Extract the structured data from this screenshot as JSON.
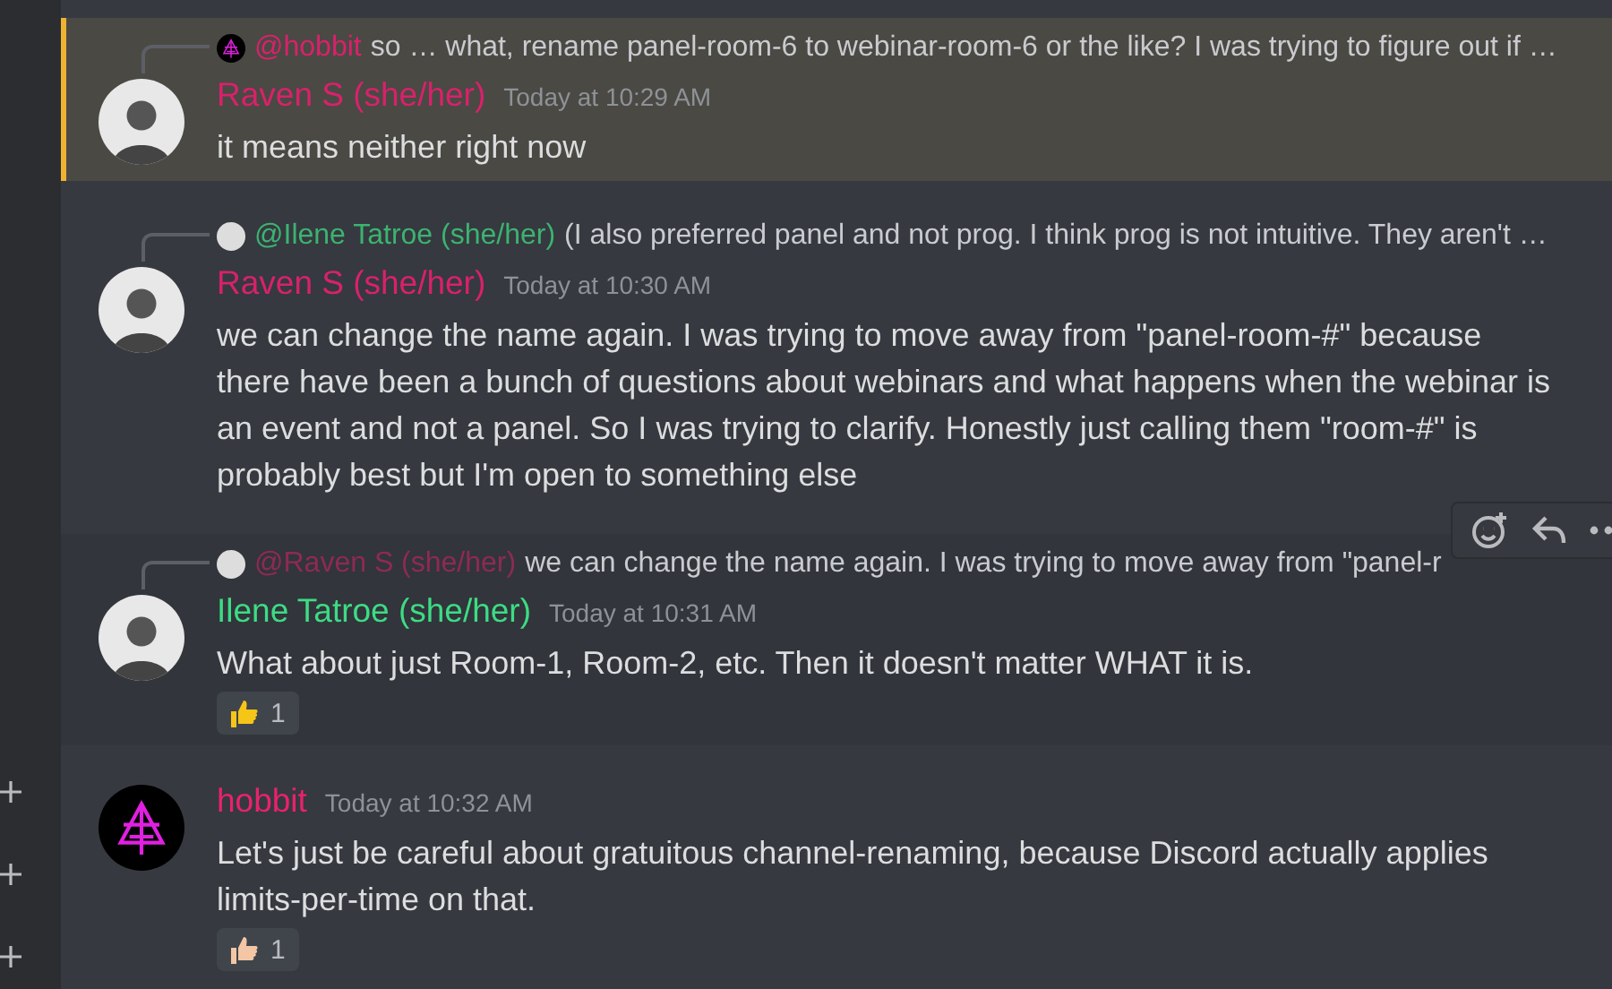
{
  "messages": [
    {
      "mentioned": true,
      "hovered": false,
      "avatar": {
        "kind": "photo"
      },
      "author": "Raven S (she/her)",
      "color": "#d9216b",
      "time": "Today at 10:29 AM",
      "reply": {
        "avatar": {
          "kind": "sigil"
        },
        "author": "@hobbit",
        "color": "#d9216b",
        "text": "so … what, rename panel-room-6 to webinar-room-6 or the like?  I was trying to figure out if …"
      },
      "text": "it means neither right now"
    },
    {
      "mentioned": false,
      "hovered": false,
      "avatar": {
        "kind": "photo"
      },
      "author": "Raven S (she/her)",
      "color": "#d9216b",
      "time": "Today at 10:30 AM",
      "reply": {
        "avatar": {
          "kind": "photo"
        },
        "author": "@Ilene Tatroe (she/her)",
        "color": "#3cb371",
        "text": "(I also preferred panel and not prog. I think prog is not intuitive. They aren't …"
      },
      "text": "we can change the name again. I was trying to move away from \"panel-room-#\" because there have been a bunch of questions about webinars and what happens when the webinar is an event and not a panel. So I was trying to clarify. Honestly just calling them \"room-#\" is probably best but I'm open to something else"
    },
    {
      "mentioned": false,
      "hovered": true,
      "avatar": {
        "kind": "photo"
      },
      "author": "Ilene Tatroe (she/her)",
      "color": "#3ddc84",
      "time": "Today at 10:31 AM",
      "reply": {
        "avatar": {
          "kind": "photo"
        },
        "author": "@Raven S (she/her)",
        "color": "#8e2a55",
        "text": "we can change the name again. I was trying to move away from \"panel-r"
      },
      "text": "What about just Room-1, Room-2, etc. Then it doesn't matter WHAT it is.",
      "reactions": [
        {
          "count": "1",
          "color": "#f5c518"
        }
      ]
    },
    {
      "mentioned": false,
      "hovered": false,
      "avatar": {
        "kind": "sigil"
      },
      "author": "hobbit",
      "color": "#e8226e",
      "time": "Today at 10:32 AM",
      "text": "Let's just be careful about gratuitous channel-renaming, because Discord actually applies limits-per-time on that.",
      "reactions": [
        {
          "count": "1",
          "color": "#f3c6a5"
        }
      ]
    }
  ]
}
